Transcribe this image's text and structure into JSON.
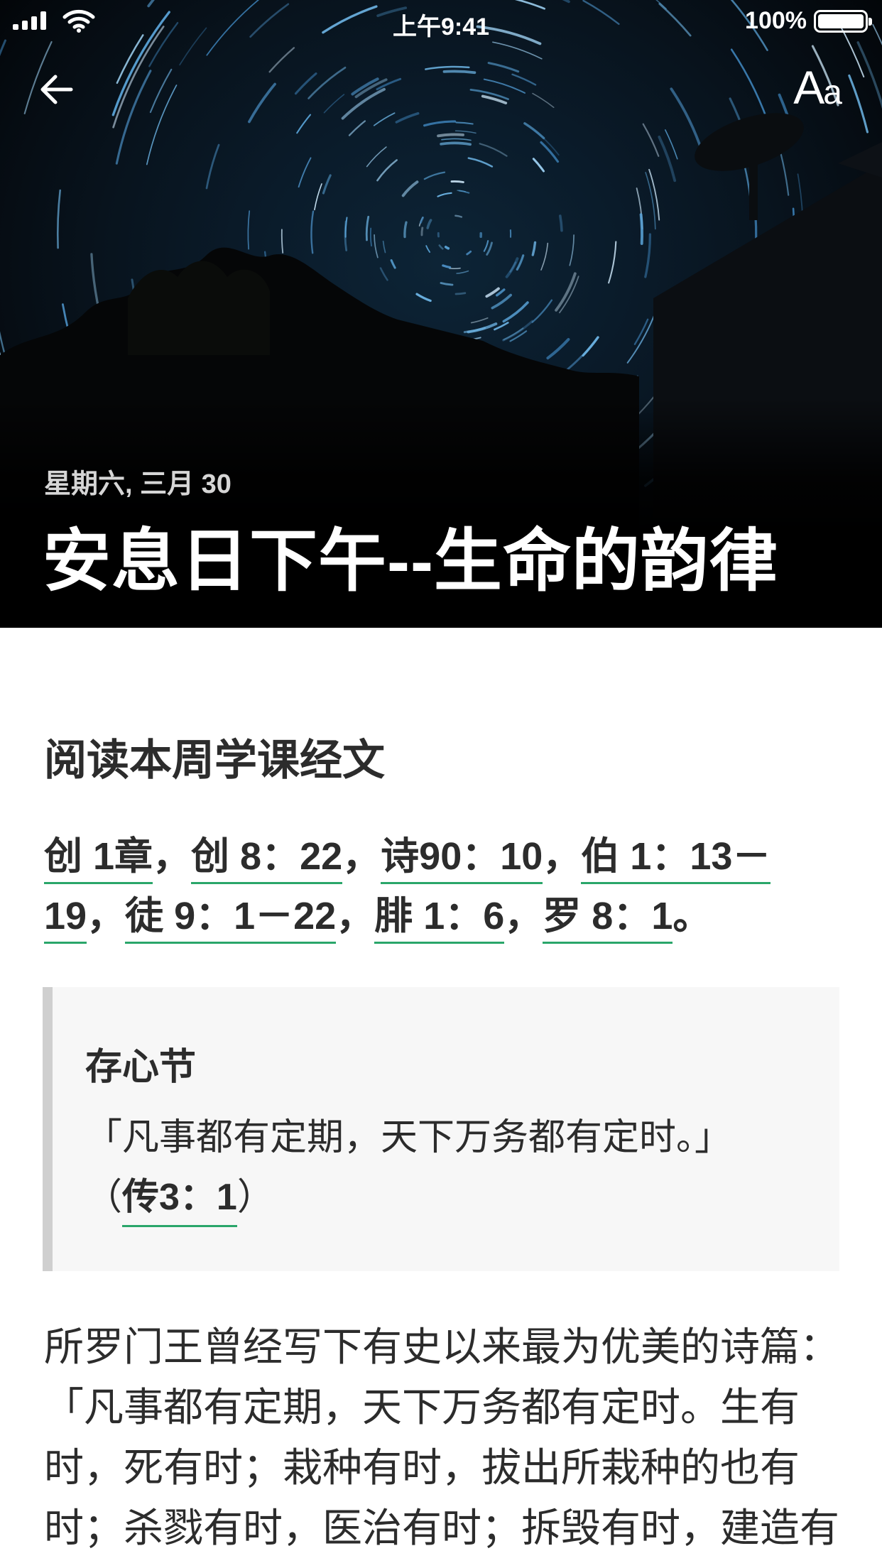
{
  "status_bar": {
    "time": "上午9:41",
    "battery_percent": "100%",
    "battery_level": 1.0
  },
  "header": {
    "back_icon": "arrow-left-icon",
    "font_size_button": {
      "big": "A",
      "small": "a"
    },
    "date": "星期六, 三月 30",
    "title": "安息日下午--生命的韵律"
  },
  "reading": {
    "heading": "阅读本周学课经文",
    "refs": [
      "创 1章",
      "创 8：22",
      "诗90：10",
      "伯 1：13－19",
      "徒 9：1－22",
      "腓 1：6",
      "罗 8：1"
    ],
    "separator": "，",
    "end": "。"
  },
  "memory_verse": {
    "label": "存心节",
    "text": "「凡事都有定期，天下万务都有定时。」",
    "open_paren": "（",
    "ref": "传3：1",
    "close_paren": "）"
  },
  "body": {
    "paragraph": "所罗门王曾经写下有史以来最为优美的诗篇：「凡事都有定期，天下万务都有定时。生有时，死有时；栽种有时，拔出所栽种的也有时；杀戮有时，医治有时；拆毁有时，建造有时；哭有时，笑有时；哀恸有时，跳"
  },
  "colors": {
    "link_underline": "#2aa66a",
    "quote_bar": "#cfcfcf",
    "quote_bg": "#f7f7f7"
  }
}
